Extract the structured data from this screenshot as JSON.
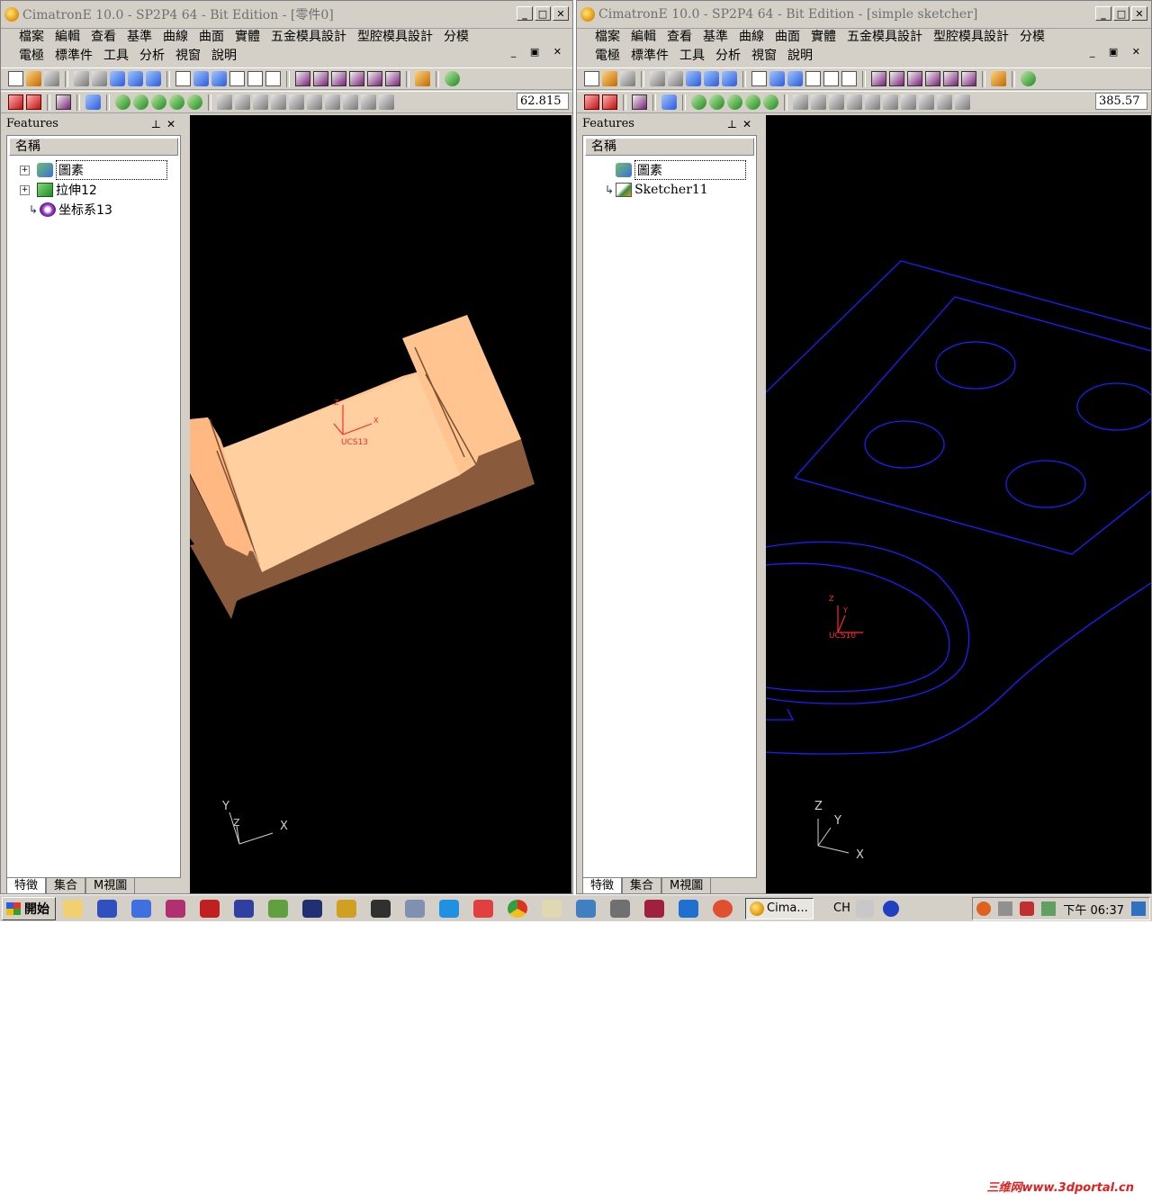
{
  "left_window": {
    "title": "CimatronE 10.0 - SP2P4 64 - Bit Edition - [零件0]",
    "menu_row1": [
      "檔案",
      "編輯",
      "查看",
      "基準",
      "曲線",
      "曲面",
      "實體",
      "五金模具設計",
      "型腔模具設計",
      "分模"
    ],
    "menu_row2": [
      "電極",
      "標準件",
      "工具",
      "分析",
      "視窗",
      "說明"
    ],
    "zoom_value": "62.815",
    "panel_title": "Features",
    "tree_header": "名稱",
    "tree": [
      {
        "label": "圖素",
        "icon": "geometry-icon",
        "expander": "+"
      },
      {
        "label": "拉伸12",
        "icon": "extrude-icon",
        "expander": "+"
      },
      {
        "label": "坐标系13",
        "icon": "ucs-icon",
        "expander": ""
      }
    ],
    "tabs": [
      "特徵",
      "集合",
      "M視圖"
    ],
    "ucs_label": "UCS13",
    "axes": {
      "x": "X",
      "y": "Y",
      "z": "Z"
    }
  },
  "right_window": {
    "title": "CimatronE 10.0 - SP2P4 64 - Bit Edition - [simple sketcher]",
    "menu_row1": [
      "檔案",
      "編輯",
      "查看",
      "基準",
      "曲線",
      "曲面",
      "實體",
      "五金模具設計",
      "型腔模具設計",
      "分模"
    ],
    "menu_row2": [
      "電極",
      "標準件",
      "工具",
      "分析",
      "視窗",
      "說明"
    ],
    "zoom_value": "385.57",
    "panel_title": "Features",
    "tree_header": "名稱",
    "tree": [
      {
        "label": "圖素",
        "icon": "geometry-icon",
        "expander": ""
      },
      {
        "label": "Sketcher11",
        "icon": "sketch-icon",
        "expander": ""
      }
    ],
    "tabs": [
      "特徵",
      "集合",
      "M視圖"
    ],
    "ucs_label": "UCS10",
    "axes": {
      "x": "X",
      "y": "Y",
      "z": "Z"
    }
  },
  "taskbar": {
    "start_label": "開始",
    "task_button": "Cima...",
    "lang": "CH",
    "clock": "下午 06:37"
  },
  "watermark": "三维网www.3dportal.cn",
  "colors": {
    "part_face": "#ffc48f",
    "part_side": "#8a5a3c",
    "sketch_line": "#1e1eff",
    "ucs": "#ff2a2a"
  }
}
